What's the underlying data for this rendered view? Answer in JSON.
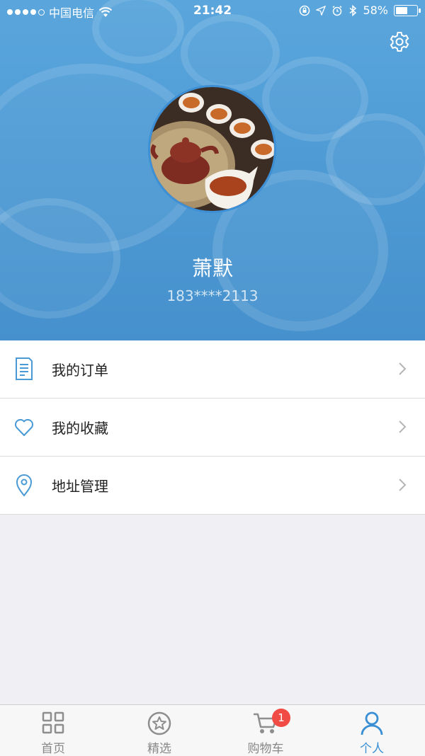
{
  "status_bar": {
    "carrier": "中国电信",
    "time": "21:42",
    "battery_percent": "58%",
    "battery_level": 0.58
  },
  "profile": {
    "name": "萧默",
    "phone": "183****2113"
  },
  "menu": [
    {
      "label": "我的订单",
      "icon": "order-list-icon"
    },
    {
      "label": "我的收藏",
      "icon": "heart-icon"
    },
    {
      "label": "地址管理",
      "icon": "location-pin-icon"
    }
  ],
  "tabbar": {
    "tabs": [
      {
        "label": "首页",
        "icon": "grid-icon",
        "active": false
      },
      {
        "label": "精选",
        "icon": "star-circle-icon",
        "active": false
      },
      {
        "label": "购物车",
        "icon": "cart-icon",
        "active": false
      },
      {
        "label": "个人",
        "icon": "person-icon",
        "active": true
      }
    ],
    "cart_badge": "1"
  },
  "colors": {
    "header_blue": "#4f9bd5",
    "accent": "#3a8fd4",
    "badge_red": "#f04b44",
    "background": "#efeff4"
  }
}
